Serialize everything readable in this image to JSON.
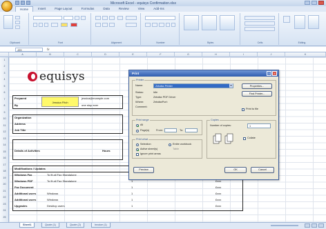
{
  "window": {
    "title": "Microsoft Excel - equisys Confirmation.xlsx"
  },
  "tabs": [
    "Home",
    "Insert",
    "Page Layout",
    "Formulas",
    "Data",
    "Review",
    "View",
    "Add-Ins"
  ],
  "ribbon_groups": [
    "Clipboard",
    "Font",
    "Alignment",
    "Number",
    "Styles",
    "Cells",
    "Editing"
  ],
  "formula_bar": {
    "name_box": "J29",
    "fx": "fx"
  },
  "sheet": {
    "logo_text": "equisys",
    "rows": [
      {
        "label": "Prepared",
        "value": "Jessica Fitch",
        "note": "jessica@example.com"
      },
      {
        "label": "By",
        "value": "",
        "note": "one stop ever"
      }
    ],
    "fields": [
      "Organization",
      "Address",
      "Job Title"
    ],
    "details_label": "Details of Activities",
    "details_right": "Hours",
    "table_header": "Modifications / Updates",
    "table_rows": [
      {
        "name": "Windows Fax",
        "desc": "To fit all Fax Standalone",
        "qty": "1",
        "price": "£xxx"
      },
      {
        "name": "Windows PDF",
        "desc": "To fit all Fax Standalone",
        "qty": "1",
        "price": "£xxx"
      },
      {
        "name": "Fax Document",
        "desc": "",
        "qty": "1",
        "price": "£xxx"
      },
      {
        "name": "Additional users",
        "desc": "Windows",
        "qty": "1",
        "price": "£xxx"
      },
      {
        "name": "Additional users",
        "desc": "Windows",
        "qty": "1",
        "price": "£xxx"
      },
      {
        "name": "Upgrades",
        "desc": "Desktop users",
        "qty": "1",
        "price": "£xxx"
      }
    ]
  },
  "print_dialog": {
    "title": "Print",
    "printer_group": "Printer",
    "name_label": "Name:",
    "name_value": "Zetafax Printer",
    "status_label": "Status:",
    "status_value": "Idle",
    "type_label": "Type:",
    "type_value": "Zetafax PDF Driver",
    "where_label": "Where:",
    "where_value": "ZetafaxPort:",
    "comment_label": "Comment:",
    "comment_value": "",
    "properties_btn": "Properties...",
    "find_printer_btn": "Find Printer...",
    "print_to_file": "Print to file",
    "range_group": "Print range",
    "range_all": "All",
    "range_pages": "Page(s)",
    "from_label": "From:",
    "to_label": "To:",
    "what_group": "Print what",
    "what_selection": "Selection",
    "what_active": "Active sheet(s)",
    "what_entire": "Entire workbook",
    "what_table": "Table",
    "ignore_label": "Ignore print areas",
    "copies_group": "Copies",
    "copies_label": "Number of copies:",
    "copies_value": "1",
    "collate": "Collate",
    "preview_btn": "Preview",
    "ok_btn": "OK",
    "cancel_btn": "Cancel"
  },
  "sheet_tabs": [
    "Sheet1",
    "Quote (1)",
    "Quote (2)",
    "Invoice (1)"
  ],
  "colors": {
    "accent": "#c8102e",
    "highlight": "#fff96a",
    "dialog_title": "#2f5caf"
  }
}
